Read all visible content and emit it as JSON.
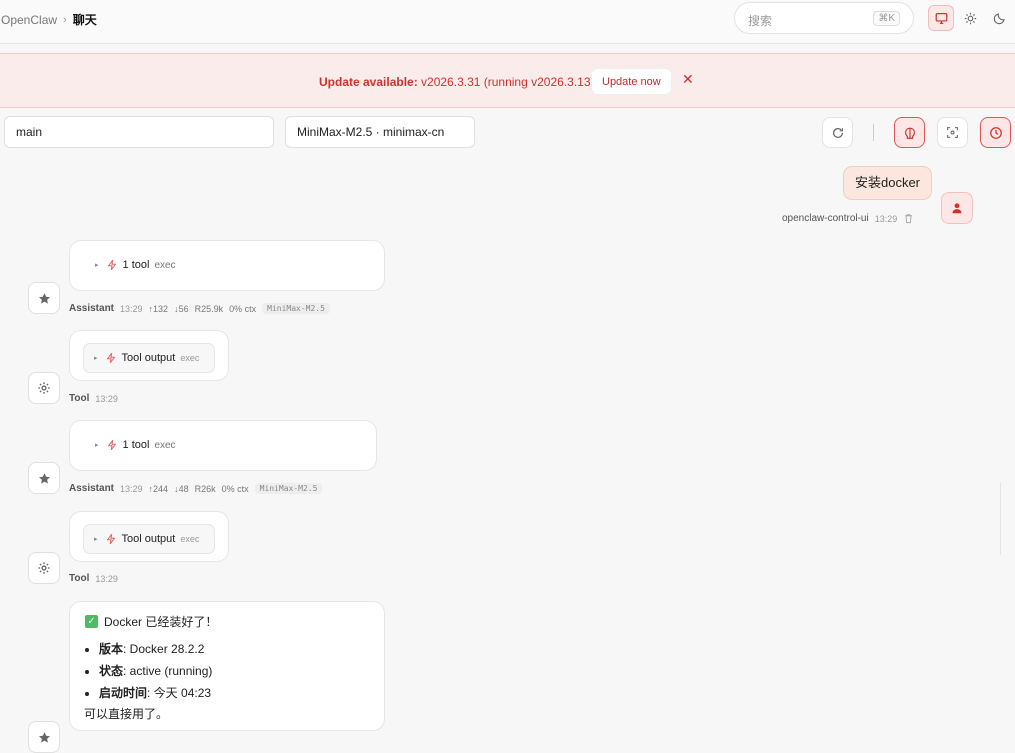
{
  "breadcrumb": {
    "app": "OpenClaw",
    "separator": "›",
    "current": "聊天"
  },
  "search": {
    "placeholder": "搜索",
    "shortcut": "⌘K"
  },
  "theme": {
    "options": [
      "monitor-icon",
      "sun-icon",
      "moon-icon"
    ],
    "active": "monitor"
  },
  "banner": {
    "label": "Update available:",
    "text": " v2026.3.31 (running v2026.3.13).",
    "button": "Update now",
    "close": "✕"
  },
  "selectors": {
    "session": "main",
    "model": "MiniMax-M2.5 · minimax-cn"
  },
  "toolbar": {
    "icons": [
      "refresh-icon",
      "brain-icon",
      "focus-icon",
      "history-icon"
    ]
  },
  "user_message": {
    "text": "安装docker",
    "sender": "openclaw-control-ui",
    "time": "13:29"
  },
  "messages": [
    {
      "role": "Assistant",
      "time": "13:29",
      "tool_label": "1 tool",
      "tool_name": "exec",
      "stats": {
        "up": "↑132",
        "down": "↓56",
        "read": "R25.9k",
        "ctx": "0% ctx"
      },
      "model": "MiniMax-M2.5"
    },
    {
      "role": "Tool",
      "time": "13:29",
      "tool_label": "Tool output",
      "tool_name": "exec"
    },
    {
      "role": "Assistant",
      "time": "13:29",
      "tool_label": "1 tool",
      "tool_name": "exec",
      "stats": {
        "up": "↑244",
        "down": "↓48",
        "read": "R26k",
        "ctx": "0% ctx"
      },
      "model": "MiniMax-M2.5"
    },
    {
      "role": "Tool",
      "time": "13:29",
      "tool_label": "Tool output",
      "tool_name": "exec"
    }
  ],
  "final_message": {
    "check": "✓",
    "heading": "Docker 已经装好了！",
    "items": [
      {
        "key": "版本",
        "value": ": Docker 28.2.2"
      },
      {
        "key": "状态",
        "value": ": active (running)"
      },
      {
        "key": "启动时间",
        "value": ": 今天 04:23"
      }
    ],
    "footer": "可以直接用了。"
  },
  "colors": {
    "accent": "#d0312d",
    "banner_bg": "#fbecec",
    "user_bubble": "#fbe7dd"
  }
}
